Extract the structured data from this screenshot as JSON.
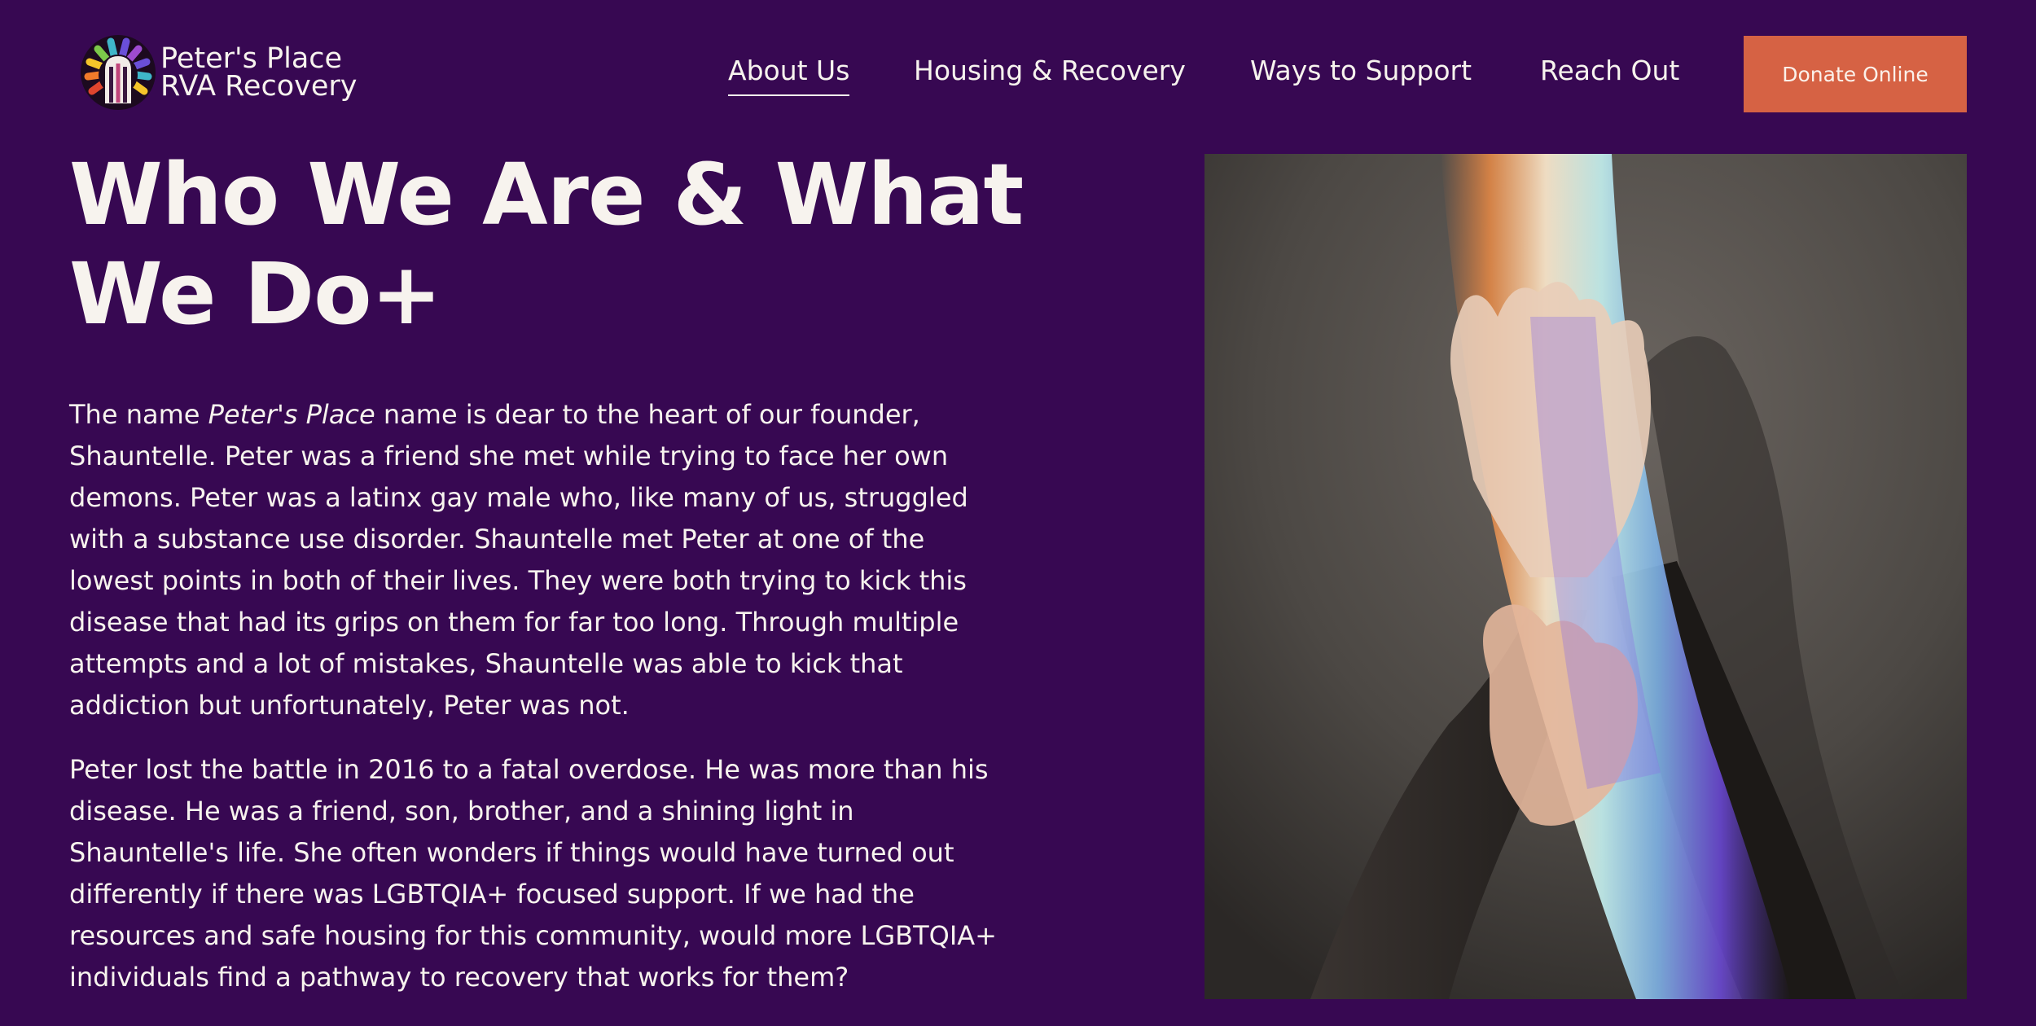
{
  "header": {
    "logo": {
      "line1": "Peter's Place",
      "line2": "RVA Recovery",
      "icon": "rainbow-arch-logo-icon"
    },
    "nav": [
      {
        "label": "About Us",
        "active": true
      },
      {
        "label": "Housing & Recovery",
        "active": false
      },
      {
        "label": "Ways to Support",
        "active": false
      },
      {
        "label": "Reach Out",
        "active": false
      }
    ],
    "donate_label": "Donate Online"
  },
  "main": {
    "title_line1": "Who We Are & What",
    "title_line2": "We Do+",
    "paragraph1": {
      "lead": "The name ",
      "emphasis": "Peter's Place",
      "rest": " name is dear to the heart of our founder, Shauntelle. Peter was a friend she met while trying to face her own demons. Peter was a latinx gay male who, like many of us, struggled with a substance use disorder. Shauntelle met Peter at one of the lowest points in both of their lives. They were both trying to kick this disease that had its grips on them for far too long. Through multiple attempts and a lot of mistakes, Shauntelle was able to kick that addiction but unfortunately, Peter was not."
    },
    "paragraph2": "Peter lost the battle in 2016 to a fatal overdose. He was more than his disease. He was a friend, son, brother, and a shining light in Shauntelle's life. She often wonders if things would have turned out differently if there was LGBTQIA+ focused support. If we had the resources and safe housing for this community, would more LGBTQIA+ individuals find a pathway to recovery that works for them?",
    "image": {
      "subject": "hands-in-rainbow-light-photo"
    }
  },
  "colors": {
    "background": "#370852",
    "text": "#f7f3ee",
    "accent": "#d66244"
  }
}
